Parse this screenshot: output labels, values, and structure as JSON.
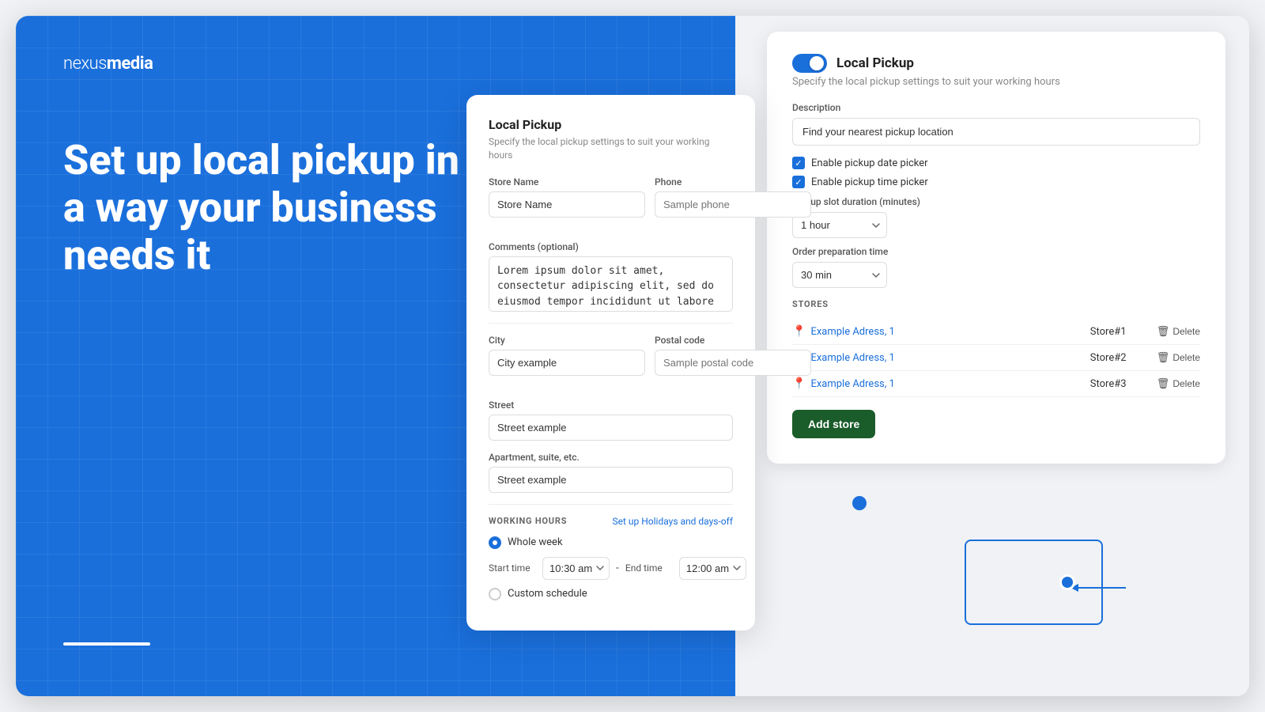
{
  "brand": {
    "name_light": "nexus",
    "name_bold": "media"
  },
  "hero": {
    "title": "Set up local pickup in a way your business needs it"
  },
  "store_form": {
    "title": "Local Pickup",
    "subtitle": "Specify the local pickup settings to suit your working hours",
    "store_name_label": "Store Name",
    "store_name_placeholder": "Store Name",
    "phone_label": "Phone",
    "phone_placeholder": "Sample phone",
    "comments_label": "Comments (optional)",
    "comments_value": "Lorem ipsum dolor sit amet, consectetur adipiscing elit, sed do eiusmod tempor incididunt ut labore et dolore",
    "city_label": "City",
    "city_placeholder": "City example",
    "postal_code_label": "Postal code",
    "postal_code_placeholder": "Sample postal code",
    "street_label": "Street",
    "street_placeholder": "Street example",
    "apartment_label": "Apartment, suite, etc.",
    "apartment_placeholder": "Street example",
    "working_hours_label": "WORKING HOURS",
    "setup_holidays_link": "Set up Holidays and days-off",
    "whole_week_label": "Whole week",
    "start_time_label": "Start time",
    "start_time_value": "10:30 am",
    "end_time_label": "End time",
    "end_time_value": "12:00 am",
    "custom_schedule_label": "Custom schedule"
  },
  "settings": {
    "title": "Local Pickup",
    "description_label": "Description",
    "description_placeholder": "Find your nearest pickup location",
    "enable_date_picker_label": "Enable pickup date picker",
    "enable_time_picker_label": "Enable pickup time picker",
    "slot_duration_label": "Pickup slot duration (minutes)",
    "slot_duration_value": "1 hour",
    "preparation_time_label": "Order preparation time",
    "preparation_time_value": "30 min",
    "stores_label": "STORES",
    "stores": [
      {
        "address": "Example Adress, 1",
        "name": "Store#1"
      },
      {
        "address": "Example Adress, 1",
        "name": "Store#2"
      },
      {
        "address": "Example Adress, 1",
        "name": "Store#3"
      }
    ],
    "delete_label": "Delete",
    "add_store_label": "Add store"
  }
}
